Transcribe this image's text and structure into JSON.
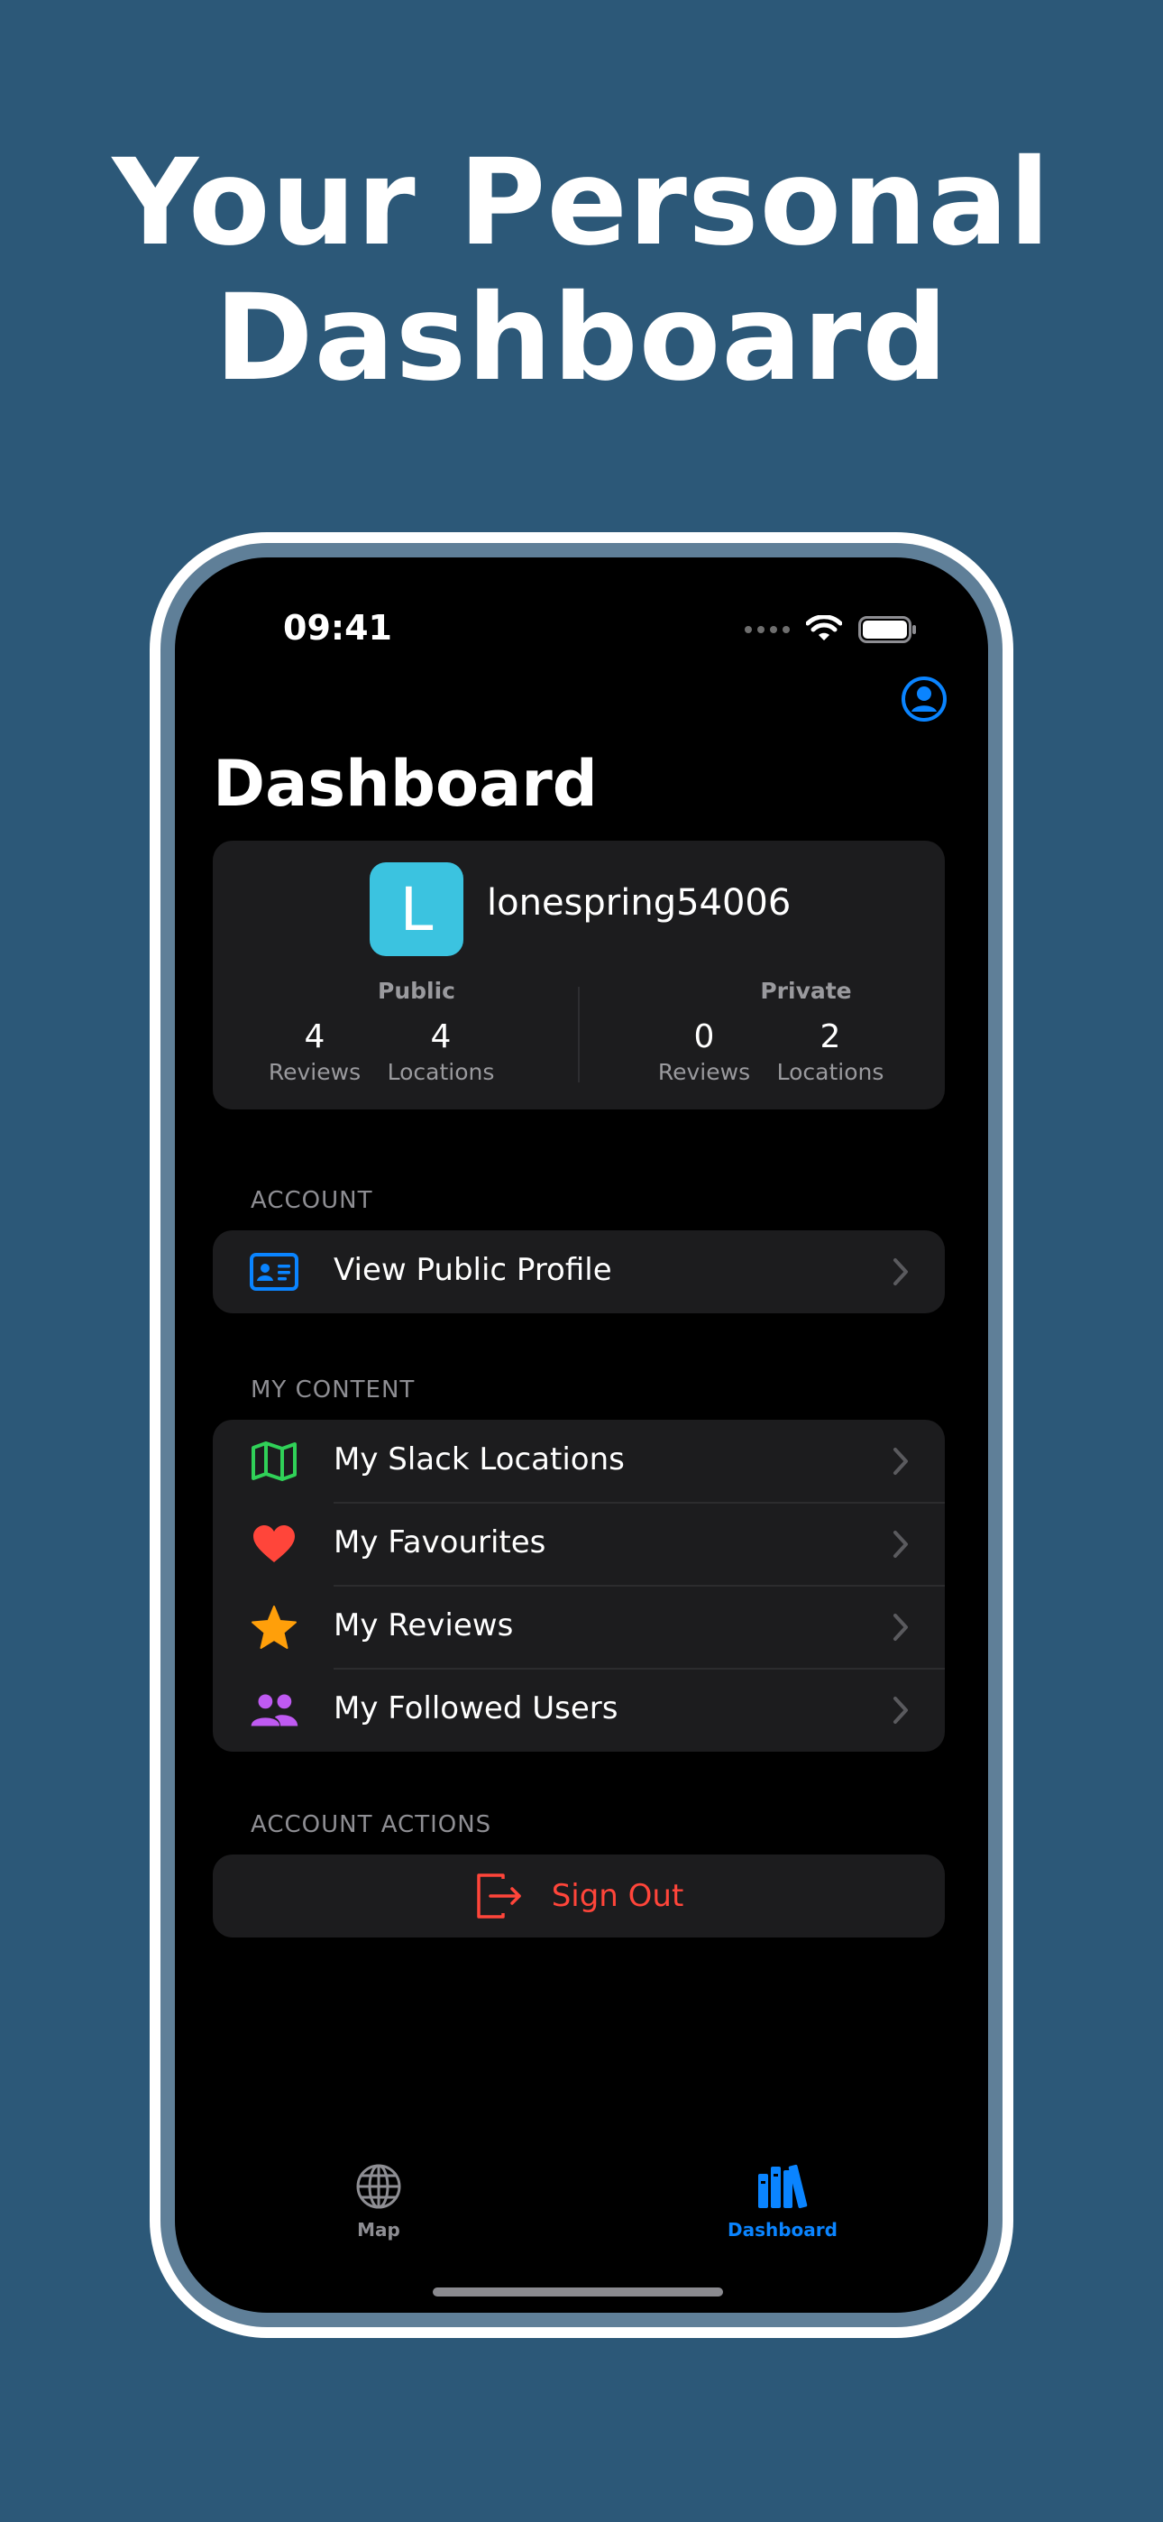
{
  "headline": {
    "line1": "Your Personal",
    "line2": "Dashboard"
  },
  "status_bar": {
    "time": "09:41"
  },
  "screen": {
    "title": "Dashboard",
    "profile": {
      "avatar_letter": "L",
      "avatar_color": "#3bc3e0",
      "username": "lonespring54006",
      "public": {
        "title": "Public",
        "reviews": {
          "value": "4",
          "label": "Reviews"
        },
        "locations": {
          "value": "4",
          "label": "Locations"
        }
      },
      "private": {
        "title": "Private",
        "reviews": {
          "value": "0",
          "label": "Reviews"
        },
        "locations": {
          "value": "2",
          "label": "Locations"
        }
      }
    },
    "sections": {
      "account": {
        "header": "ACCOUNT",
        "items": [
          {
            "label": "View Public Profile",
            "icon": "id-card-icon",
            "color": "#0a84ff"
          }
        ]
      },
      "my_content": {
        "header": "MY CONTENT",
        "items": [
          {
            "label": "My Slack Locations",
            "icon": "map-icon",
            "color": "#30d158"
          },
          {
            "label": "My Favourites",
            "icon": "heart-icon",
            "color": "#ff453a"
          },
          {
            "label": "My Reviews",
            "icon": "star-icon",
            "color": "#ff9f0a"
          },
          {
            "label": "My Followed Users",
            "icon": "people-icon",
            "color": "#bf5af2"
          }
        ]
      },
      "account_actions": {
        "header": "ACCOUNT ACTIONS",
        "sign_out": {
          "label": "Sign Out",
          "icon": "sign-out-icon",
          "color": "#ff453a"
        }
      }
    },
    "tabbar": {
      "tabs": [
        {
          "label": "Map",
          "icon": "globe-icon",
          "selected": false
        },
        {
          "label": "Dashboard",
          "icon": "books-icon",
          "selected": true
        }
      ],
      "accent_color": "#0a84ff",
      "inactive_color": "#8e8e93"
    }
  }
}
